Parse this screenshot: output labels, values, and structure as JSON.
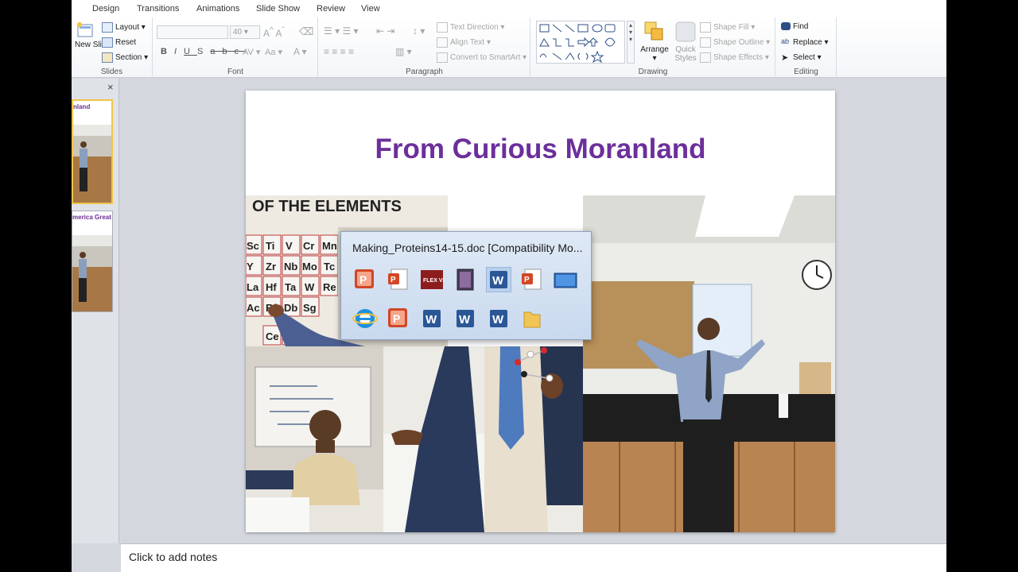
{
  "ribbon_tabs": [
    "Design",
    "Transitions",
    "Animations",
    "Slide Show",
    "Review",
    "View"
  ],
  "slides_group": {
    "new_slide": "New Slide",
    "layout": "Layout",
    "reset": "Reset",
    "section": "Section",
    "label": "Slides"
  },
  "font_group": {
    "size": "40",
    "label": "Font"
  },
  "paragraph_group": {
    "text_direction": "Text Direction",
    "align_text": "Align Text",
    "convert_smartart": "Convert to SmartArt",
    "label": "Paragraph"
  },
  "drawing_group": {
    "arrange": "Arrange",
    "quick_styles": "Quick Styles",
    "shape_fill": "Shape Fill",
    "shape_outline": "Shape Outline",
    "shape_effects": "Shape Effects",
    "label": "Drawing"
  },
  "editing_group": {
    "find": "Find",
    "replace": "Replace",
    "select": "Select",
    "label": "Editing"
  },
  "thumbnails": [
    {
      "title": "nland"
    },
    {
      "title": "merica Great"
    }
  ],
  "slide": {
    "title": "From Curious Moranland"
  },
  "notes": {
    "placeholder": "Click to add notes"
  },
  "popup": {
    "title": "Making_Proteins14-15.doc [Compatibility Mo...",
    "icons_row1": [
      "powerpoint-icon",
      "powerpoint-doc-icon",
      "flexview-icon",
      "media-icon",
      "word-icon",
      "powerpoint-doc-icon",
      "desktop-icon"
    ],
    "icons_row2": [
      "internet-explorer-icon",
      "powerpoint-icon",
      "word-icon",
      "word-icon",
      "word-icon",
      "folder-icon"
    ]
  }
}
